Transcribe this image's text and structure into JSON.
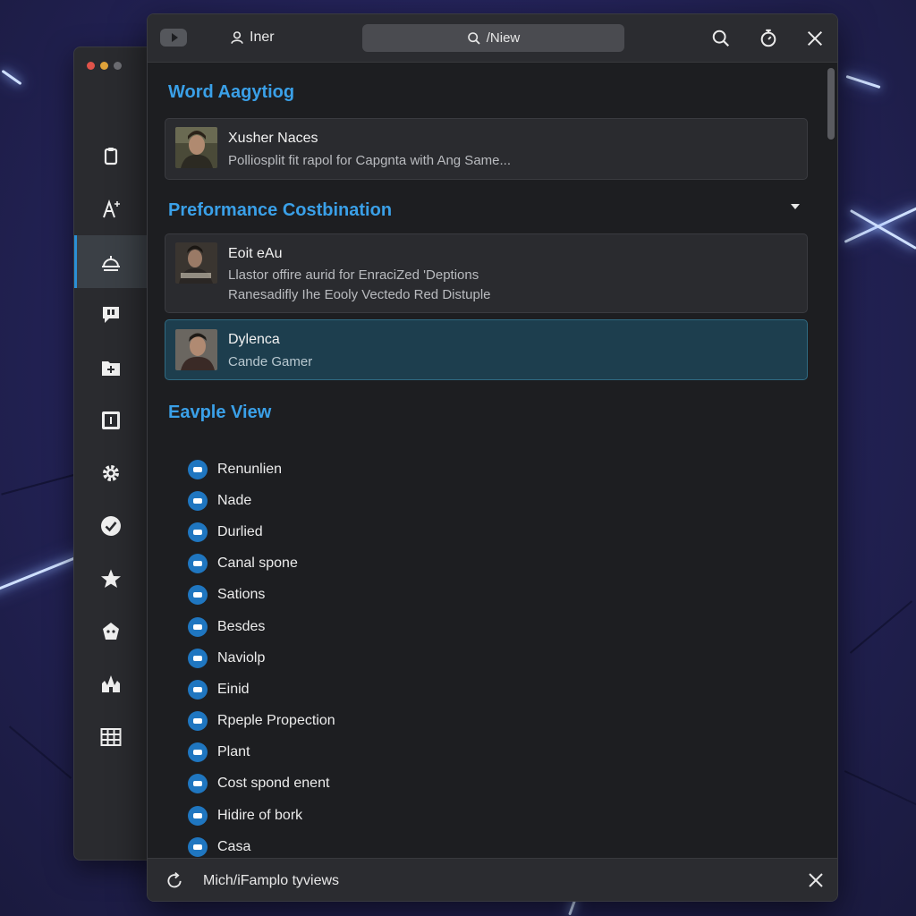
{
  "titlebar": {
    "user_label": "Iner",
    "search_label": "/Niew"
  },
  "sidebar": {
    "icons": [
      {
        "name": "clipboard-icon"
      },
      {
        "name": "font-icon"
      },
      {
        "name": "dome-icon",
        "active": true
      },
      {
        "name": "chat-icon"
      },
      {
        "name": "folder-plus-icon"
      },
      {
        "name": "window-icon"
      },
      {
        "name": "gear-icon"
      },
      {
        "name": "checkmark-icon"
      },
      {
        "name": "star-icon"
      },
      {
        "name": "badge-icon"
      },
      {
        "name": "castle-icon"
      },
      {
        "name": "grid-icon"
      }
    ]
  },
  "sections": {
    "word": {
      "title": "Word Aagytiog",
      "card": {
        "title": "Xusher Naces",
        "subtitle": "Polliosplit fit rapol for Capgnta with Ang Same..."
      }
    },
    "performance": {
      "title": "Preformance Costbination",
      "cards": [
        {
          "title": "Eoit eAu",
          "line1": "Llastor offire aurid for EnraciZed 'Deptions",
          "line2": "Ranesadifly Ihe Eooly Vectedo Red Distuple"
        },
        {
          "title": "Dylenca",
          "line1": "Cande Gamer"
        }
      ]
    },
    "example": {
      "title": "Eavple View",
      "items": [
        "Renunlien",
        "Nade",
        "Durlied",
        "Canal spone",
        "Sations",
        "Besdes",
        "Naviolp",
        "Einid",
        "Rpeple Propection",
        "Plant",
        "Cost spond enent",
        "Hidire of bork",
        "Casa"
      ]
    }
  },
  "bottombar": {
    "label": "Mich/iFamplo tyviews"
  },
  "colors": {
    "accent": "#3aa0e8",
    "selected_bg": "#1d3e4e",
    "window_bg": "#1d1e21"
  }
}
